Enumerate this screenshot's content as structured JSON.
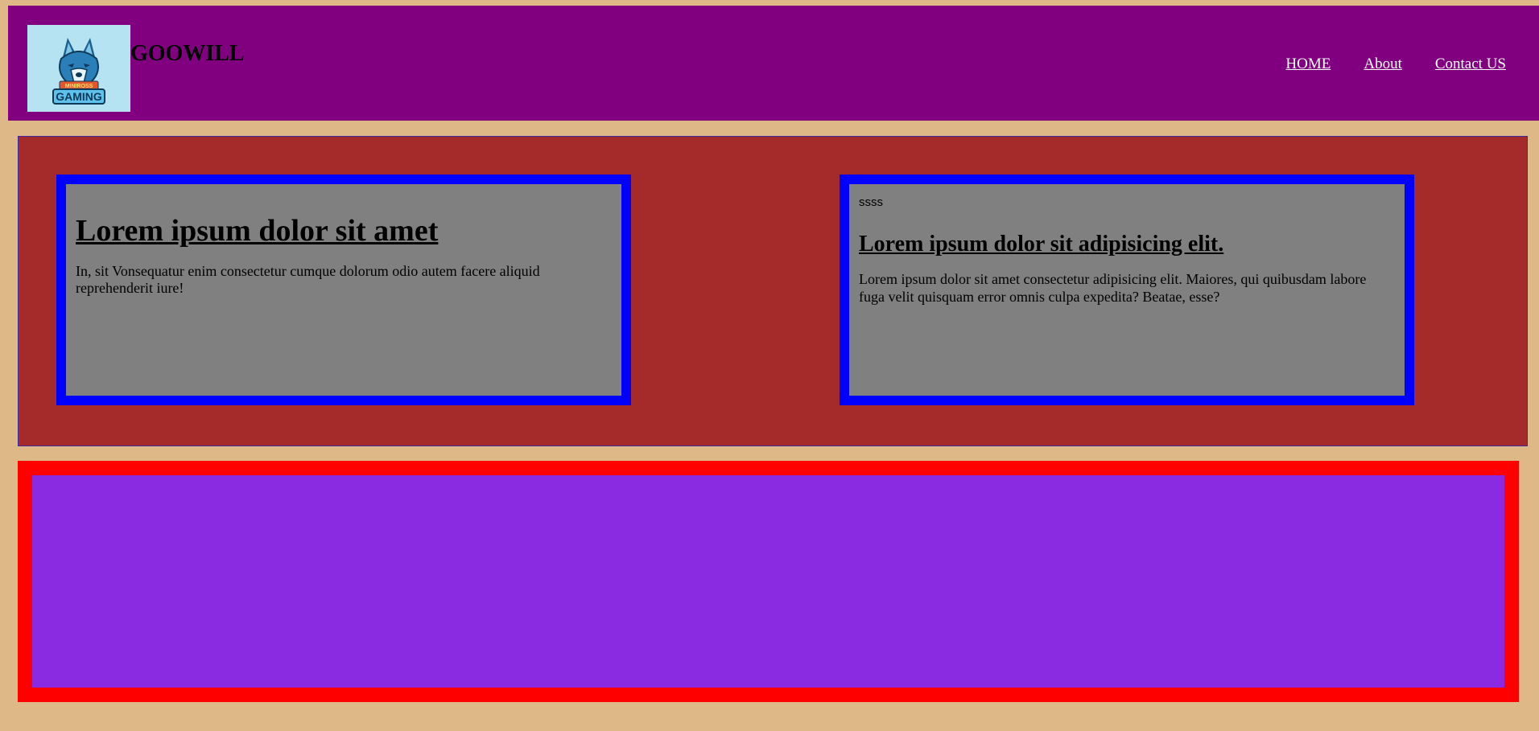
{
  "header": {
    "brand": "GOOWILL",
    "logo": {
      "icon": "wolf-mascot-logo",
      "text_top": "MINIROSS",
      "text_bottom": "GAMING"
    },
    "nav": [
      {
        "label": "HOME"
      },
      {
        "label": "About"
      },
      {
        "label": "Contact US"
      }
    ]
  },
  "cards": [
    {
      "title": "Lorem ipsum dolor sit amet",
      "body": "In, sit Vonsequatur enim consectetur cumque dolorum odio autem facere aliquid reprehenderit iure!"
    },
    {
      "label": "ssss",
      "title": "Lorem ipsum dolor sit adipisicing elit.",
      "body": "Lorem ipsum dolor sit amet consectetur adipisicing elit. Maiores, qui quibusdam labore fuga velit quisquam error omnis culpa expedita? Beatae, esse?"
    }
  ],
  "colors": {
    "page_bg": "#deb887",
    "header_bg": "#800080",
    "main_bg": "#a52a2a",
    "card_bg": "#808080",
    "card_border": "#0000ff",
    "bottom_bg": "#8a2be2",
    "bottom_border": "#ff0000"
  }
}
